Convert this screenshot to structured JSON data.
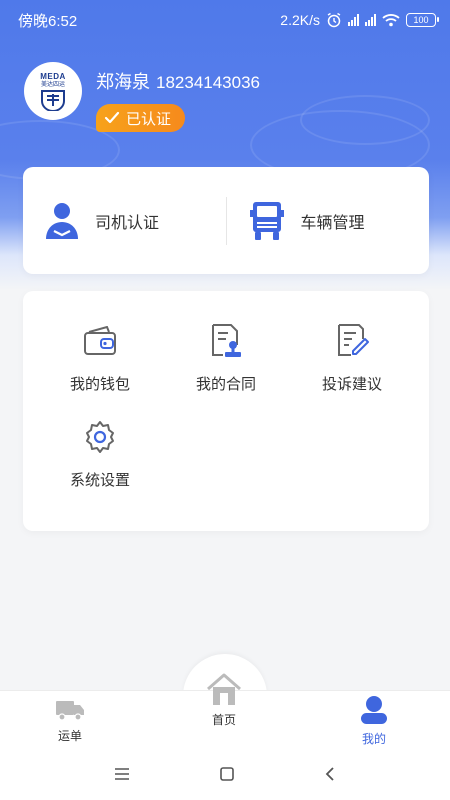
{
  "status_bar": {
    "time": "傍晚6:52",
    "speed": "2.2K/s",
    "battery": "100"
  },
  "profile": {
    "avatar_brand": "MEDA",
    "avatar_brand_cn": "美达四运",
    "name": "郑海泉",
    "phone": "18234143036",
    "verified_label": "已认证"
  },
  "quick_actions": [
    {
      "label": "司机认证",
      "icon": "driver-icon"
    },
    {
      "label": "车辆管理",
      "icon": "truck-icon"
    }
  ],
  "menu": [
    {
      "label": "我的钱包",
      "icon": "wallet-icon"
    },
    {
      "label": "我的合同",
      "icon": "contract-icon"
    },
    {
      "label": "投诉建议",
      "icon": "feedback-icon"
    },
    {
      "label": "系统设置",
      "icon": "settings-icon"
    }
  ],
  "tabbar": {
    "tabs": [
      {
        "label": "运单",
        "icon": "truck-tab-icon",
        "active": false
      },
      {
        "label": "首页",
        "icon": "home-icon",
        "active": false
      },
      {
        "label": "我的",
        "icon": "user-icon",
        "active": true
      }
    ],
    "active_color": "#3f66de",
    "inactive_color": "#888888"
  },
  "colors": {
    "primary": "#4f79ea",
    "badge": "#f7a21b"
  }
}
